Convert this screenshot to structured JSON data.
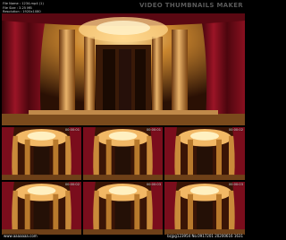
{
  "header": {
    "info_lines": [
      "File Name  : 1234.mp4 (1)",
      "File Size  : 3.25 MB",
      "Resolution : 1920x1080",
      "Duration   : 00:00:03"
    ],
    "maker_label": "VIDEO THUMBNAILS MAKER"
  },
  "thumbnails": {
    "timestamps": [
      "00:00:00",
      "00:00:01",
      "00:00:01",
      "00:00:02",
      "00:00:02",
      "00:00:03",
      "00:00:03"
    ]
  },
  "footer": {
    "left_watermark": "www.aaaaaaa.com",
    "right_watermark": "bzjpg123954 No.0917201 20200616 1631"
  },
  "colors": {
    "curtain": "#7a0d1c",
    "column": "#c98a3a",
    "glow": "#f4c070",
    "background": "#000000"
  }
}
